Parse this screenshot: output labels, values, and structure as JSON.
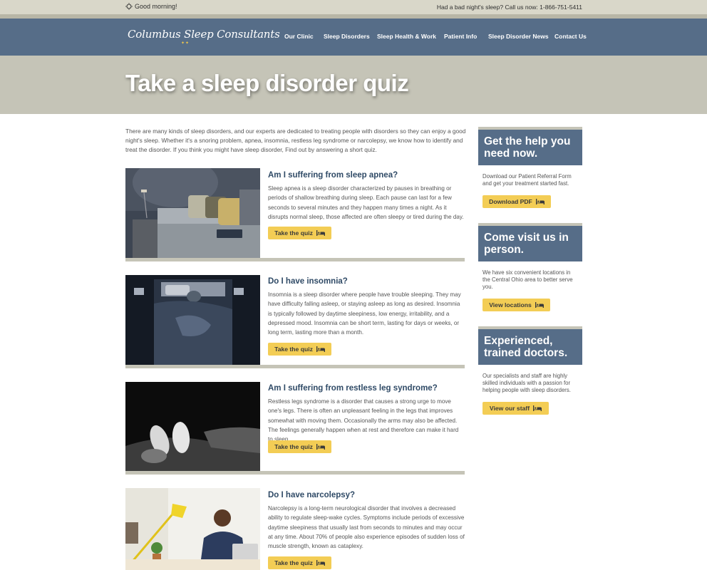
{
  "topbar": {
    "greeting": "Good morning!",
    "callus": "Had a bad night's sleep? Call us now: 1-866-751-5411"
  },
  "header": {
    "logo": "Columbus Sleep Consultants",
    "nav": [
      "Our Clinic",
      "Sleep Disorders",
      "Sleep Health & Work",
      "Patient Info",
      "Sleep Disorder News",
      "Contact Us"
    ]
  },
  "hero": {
    "title": "Take a sleep disorder quiz"
  },
  "intro": "There are many kinds of sleep disorders, and our experts are dedicated to treating people with disorders so they can enjoy a good night's sleep. Whether it's a snoring problem, apnea, insomnia, restless leg syndrome or narcolepsy, we know how to identify and treat the disorder. If you think you might have sleep disorder, Find out by answering a short quiz.",
  "quizzes": [
    {
      "title": "Am I suffering from sleep apnea?",
      "text": "Sleep apnea is a sleep disorder characterized by pauses in breathing or periods of shallow breathing during sleep. Each pause can last for a few seconds to several minutes and they happen many times a night. As it disrupts normal sleep, those affected are often sleepy or tired during the day.",
      "button": "Take the quiz"
    },
    {
      "title": "Do I have insomnia?",
      "text": "Insomnia is a sleep disorder where people have trouble sleeping. They may have difficulty falling asleep, or staying asleep as long as desired. Insomnia is typically followed by daytime sleepiness, low energy, irritability, and a depressed mood. Insomnia can be short term, lasting for days or weeks, or long term, lasting more than a month.",
      "button": "Take the quiz"
    },
    {
      "title": "Am I suffering from restless leg syndrome?",
      "text": "Restless legs syndrome is a disorder that causes a strong urge to move one's legs. There is often an unpleasant feeling in the legs that improves somewhat with moving them. Occasionally the arms may also be affected. The feelings generally happen when at rest and therefore can make it hard to sleep.",
      "button": "Take the quiz"
    },
    {
      "title": "Do I have narcolepsy?",
      "text": "Narcolepsy is a long-term neurological disorder that involves a decreased ability to regulate sleep-wake cycles. Symptoms include periods of excessive daytime sleepiness that usually last from seconds to minutes and may occur at any time. About 70% of people also experience episodes of sudden loss of muscle strength, known as cataplexy.",
      "button": "Take the quiz"
    }
  ],
  "sidebar": [
    {
      "heading": "Get the help you need now.",
      "text": "Download our Patient Referral Form and get your treatment started fast.",
      "button": "Download PDF"
    },
    {
      "heading": "Come visit us in person.",
      "text": "We have six convenient locations in the Central Ohio area to better serve you.",
      "button": "View locations"
    },
    {
      "heading": "Experienced, trained doctors.",
      "text": "Our specialists and staff are highly skilled individuals with a passion for helping people with sleep disorders.",
      "button": "View our staff"
    }
  ],
  "colors": {
    "header": "#566d88",
    "hero": "#c5c4b7",
    "button": "#f3cd55",
    "title": "#2f4a66"
  }
}
